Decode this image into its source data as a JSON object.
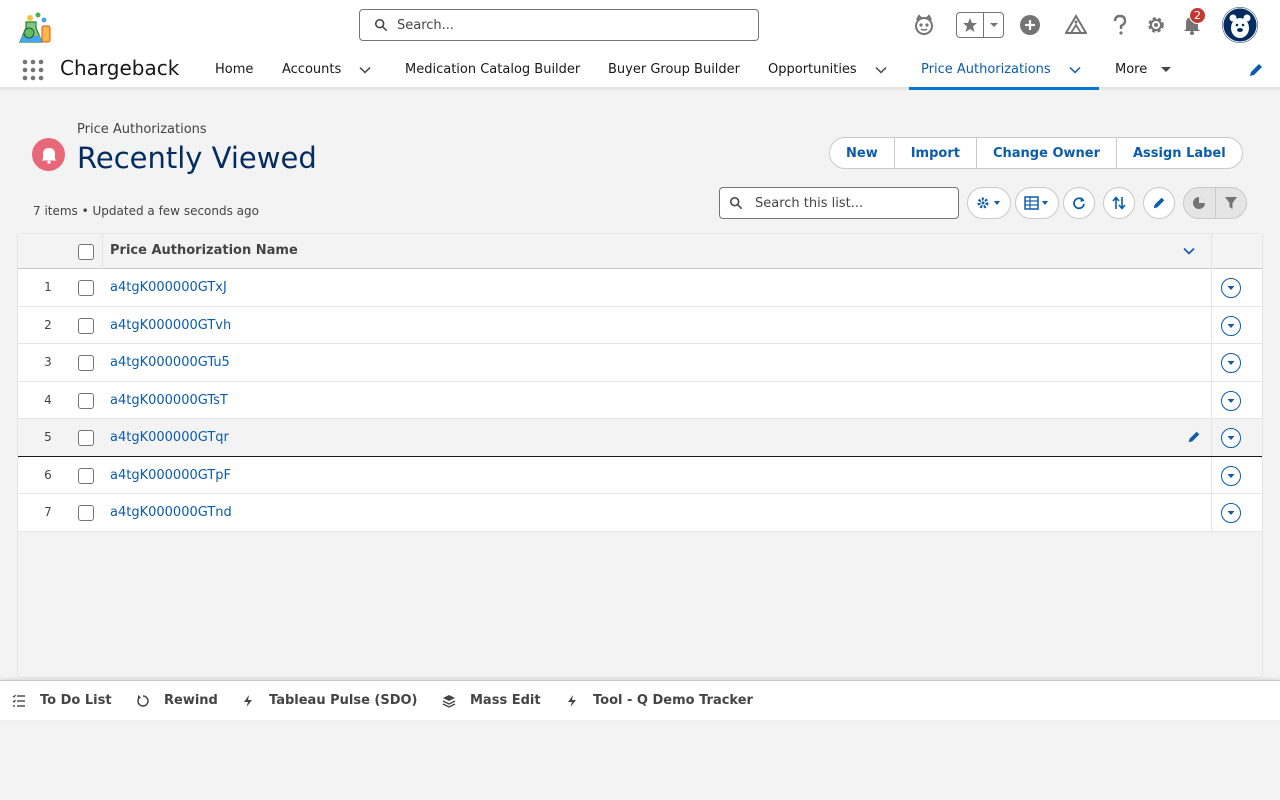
{
  "header": {
    "search_placeholder": "Search...",
    "notification_count": "2"
  },
  "nav": {
    "app_name": "Chargeback",
    "items": [
      {
        "label": "Home"
      },
      {
        "label": "Accounts"
      },
      {
        "label": "Medication Catalog Builder"
      },
      {
        "label": "Buyer Group Builder"
      },
      {
        "label": "Opportunities"
      },
      {
        "label": "Price Authorizations"
      },
      {
        "label": "More"
      }
    ],
    "active_color": "#0176d3"
  },
  "list": {
    "object_label": "Price Authorizations",
    "title": "Recently Viewed",
    "meta": "7 items • Updated a few seconds ago",
    "search_placeholder": "Search this list...",
    "buttons": {
      "new": "New",
      "import": "Import",
      "change_owner": "Change Owner",
      "assign_label": "Assign Label"
    },
    "column_header": "Price Authorization Name",
    "rows": [
      {
        "num": "1",
        "name": "a4tgK000000GTxJ"
      },
      {
        "num": "2",
        "name": "a4tgK000000GTvh"
      },
      {
        "num": "3",
        "name": "a4tgK000000GTu5"
      },
      {
        "num": "4",
        "name": "a4tgK000000GTsT"
      },
      {
        "num": "5",
        "name": "a4tgK000000GTqr"
      },
      {
        "num": "6",
        "name": "a4tgK000000GTpF"
      },
      {
        "num": "7",
        "name": "a4tgK000000GTnd"
      }
    ]
  },
  "utility_bar": {
    "items": [
      {
        "label": "To Do List",
        "icon": "checklist-icon"
      },
      {
        "label": "Rewind",
        "icon": "rewind-icon"
      },
      {
        "label": "Tableau Pulse (SDO)",
        "icon": "lightning-icon"
      },
      {
        "label": "Mass Edit",
        "icon": "layers-icon"
      },
      {
        "label": "Tool - Q Demo Tracker",
        "icon": "lightning-icon"
      }
    ]
  },
  "colors": {
    "brand_blue": "#0b5cab",
    "title_navy": "#032d60",
    "object_icon_pink": "#e8687a",
    "notification_red": "#c23934"
  }
}
